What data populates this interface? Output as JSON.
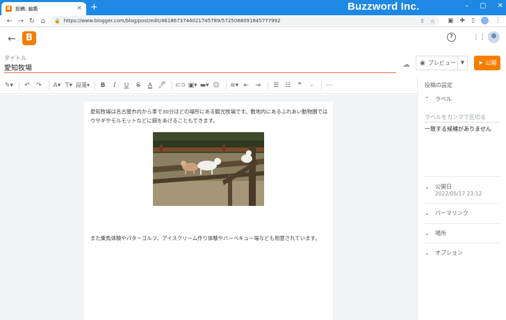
{
  "browser": {
    "tab_title": "投稿: 編集",
    "tab_close": "×",
    "new_tab": "+",
    "url": "https://www.blogger.com/blog/post/edit/4618673744021745789/5725088091845777992",
    "watermark": "Buzzword Inc.",
    "window_controls": [
      "–",
      "▢",
      "✕"
    ],
    "nav": [
      "←",
      "→",
      "↻",
      "⌂"
    ]
  },
  "app": {
    "logo": "B",
    "back": "←",
    "help": "?",
    "apps": "⋮⋮⋮"
  },
  "post": {
    "title_label": "タイトル",
    "title_value": "愛知牧場",
    "paragraph1": "愛知牧場は名古屋市内から車で30分ほどの場所にある観光牧場です。敷地内にあるふれあい動物園ではウサギやモルモットなどに餌をあげることもできます。",
    "paragraph2": "また乗馬体験やパターゴルフ、アイスクリーム作り体験やバーベキュー場なども用意されています。"
  },
  "actions": {
    "preview_label": "プレビュー",
    "publish_label": "公開"
  },
  "editor_toolbar": {
    "paragraph_label": "段落",
    "more": "⋯"
  },
  "sidebar": {
    "heading": "投稿の設定",
    "labels_title": "ラベル",
    "labels_placeholder": "ラベルをカンマで区切る",
    "labels_no_match": "一致する候補がありません",
    "publish_date_title": "公開日",
    "publish_date_value": "2022/05/17 23:12",
    "permalink_title": "パーマリンク",
    "location_title": "場所",
    "options_title": "オプション"
  },
  "colors": {
    "brand": "#f57d00",
    "browser_frame": "#1e88e5",
    "title_underline": "#ef6c57"
  }
}
